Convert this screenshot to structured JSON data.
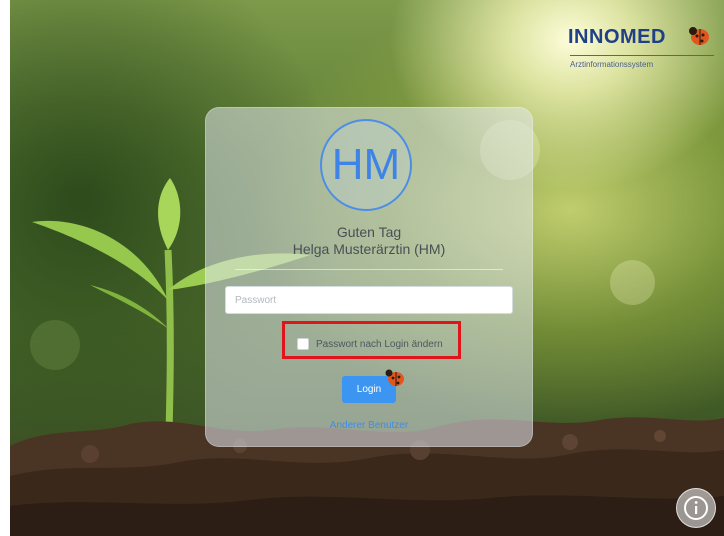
{
  "brand": {
    "name": "INNOMED",
    "tagline": "Arztinformationssystem"
  },
  "login": {
    "avatar_initials": "HM",
    "greeting": "Guten Tag",
    "user_name": "Helga Musterärztin (HM)",
    "password_placeholder": "Passwort",
    "change_password_label": "Passwort nach Login ändern",
    "change_password_checked": false,
    "login_button": "Login",
    "other_user_link": "Anderer Benutzer"
  },
  "colors": {
    "brand_blue": "#1f3f86",
    "accent_blue": "#3c95f0",
    "highlight_red": "#e0141b"
  },
  "icons": {
    "logo": "ladybug-icon",
    "login_badge": "ladybug-icon",
    "info": "info-icon"
  }
}
